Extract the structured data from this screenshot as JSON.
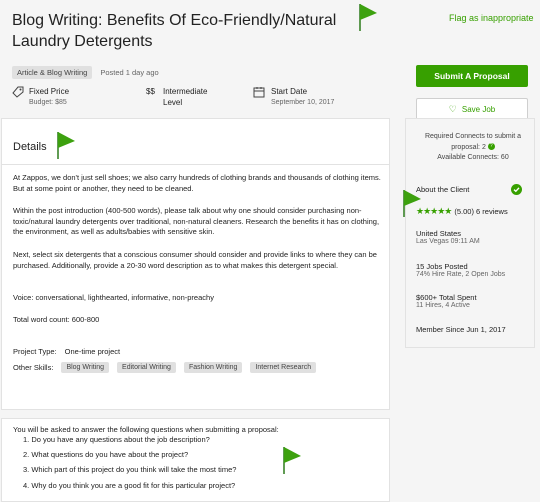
{
  "job": {
    "title": "Blog Writing: Benefits Of Eco-Friendly/Natural Laundry Detergents",
    "flag_link": "Flag as inappropriate",
    "category": "Article & Blog Writing",
    "posted": "Posted 1 day ago"
  },
  "info": {
    "price_label": "Fixed Price",
    "price_value": "Budget: $85",
    "level_symbol": "$$",
    "level_label": "Intermediate Level",
    "start_label": "Start Date",
    "start_value": "September 10, 2017"
  },
  "details": {
    "heading": "Details",
    "p1": "At Zappos, we don't just sell shoes; we also carry hundreds of clothing brands and thousands of clothing items. But at some point or another, they need to be cleaned.",
    "p2": "Within the post introduction (400-500 words), please talk about why one should consider purchasing non-toxic/natural laundry detergents over traditional, non-natural cleaners. Research the benefits it has on clothing, the environment, as well as adults/babies with sensitive skin.",
    "p3": "Next, select six detergents that a conscious consumer should consider and provide links to where they can be purchased. Additionally, provide a 20-30 word description as to what makes this detergent special.",
    "p4": "Voice: conversational, lighthearted, informative, non-preachy",
    "p5": "Total word count: 600-800",
    "project_type_label": "Project Type:",
    "project_type_value": "One-time project",
    "other_skills_label": "Other Skills:",
    "skills": [
      "Blog Writing",
      "Editorial Writing",
      "Fashion Writing",
      "Internet Research"
    ]
  },
  "questions": {
    "intro": "You will be asked to answer the following questions when submitting a proposal:",
    "items": [
      "1. Do you have any questions about the job description?",
      "2. What questions do you have about the project?",
      "3. Which part of this project do you think will take the most time?",
      "4. Why do you think you are a good fit for this particular project?"
    ]
  },
  "sidebar": {
    "submit_label": "Submit A Proposal",
    "save_label": "Save Job",
    "connects_required": "Required Connects to submit a proposal: 2",
    "help_glyph": "?",
    "connects_available": "Available Connects: 60",
    "about_heading": "About the Client",
    "rating_value": 5.0,
    "rating_text": "(5.00) 6 reviews",
    "location": "United States",
    "local_time": "Las Vegas 09:11 AM",
    "jobs_posted": "15 Jobs Posted",
    "hire_rate": "74% Hire Rate, 2 Open Jobs",
    "total_spent": "$600+ Total Spent",
    "hires": "11 Hires, 4 Active",
    "member_since": "Member Since Jun 1, 2017"
  },
  "colors": {
    "accent": "#37a000",
    "text": "#222222",
    "muted": "#656565"
  }
}
